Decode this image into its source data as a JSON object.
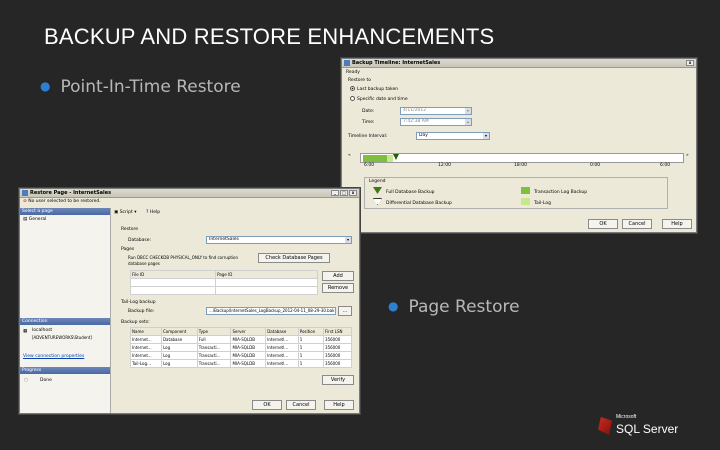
{
  "slide": {
    "title": "BACKUP AND RESTORE ENHANCEMENTS",
    "bullets": [
      "Point-In-Time Restore",
      "Page Restore"
    ]
  },
  "timeline_window": {
    "title": "Backup Timeline: InternetSales",
    "status": "Ready",
    "restore_to_label": "Restore to",
    "option_last": "Last backup taken",
    "option_specific": "Specific date and time",
    "date_label": "Date:",
    "date_value": "4/11/2012",
    "time_label": "Time:",
    "time_value": "7:42:38 AM",
    "interval_label": "Timeline Interval:",
    "interval_value": "Day",
    "ticks": [
      "6:00",
      "12:00",
      "18:00",
      "0:00",
      "6:00"
    ],
    "legend_label": "Legend",
    "legend": [
      {
        "label": "Full Database Backup",
        "color": "#3f7a1a"
      },
      {
        "label": "Transaction Log Backup",
        "color": "#7fbf3f"
      },
      {
        "label": "Differential Database Backup",
        "color": "#ffffff"
      },
      {
        "label": "Tail-Log",
        "color": "#c6e88a"
      }
    ],
    "ok": "OK",
    "cancel": "Cancel",
    "help": "Help"
  },
  "restore_window": {
    "title": "Restore Page - InternetSales",
    "warning": "No user selected to be restored.",
    "select_page": "Select a page",
    "page_general": "General",
    "toolbar_script": "Script",
    "toolbar_help": "Help",
    "restore_label": "Restore",
    "database_label": "Database:",
    "database_value": "InternetSales",
    "pages_label": "Pages",
    "pages_hint": "Run DBCC CHECKDB PHYSICAL_ONLY to find corruption",
    "pages_hint2": "database pages",
    "check_pages_btn": "Check Database Pages",
    "file_id_col": "File ID",
    "page_id_col": "Page ID",
    "add_btn": "Add",
    "remove_btn": "Remove",
    "tail_log_label": "Tail-Log backup",
    "backup_file_label": "Backup file:",
    "backup_file_value": "...\\Backup\\InternetSales_LogBackup_2012-04-11_08-29-30.bak",
    "backup_sets_label": "Backup sets:",
    "columns": [
      "Name",
      "Component",
      "Type",
      "Server",
      "Database",
      "Position",
      "First LSN"
    ],
    "rows": [
      [
        "Internet...",
        "Database",
        "Full",
        "MIA-SQLDB",
        "Internetl...",
        "1",
        "356000"
      ],
      [
        "Internet...",
        "Log",
        "Transacti...",
        "MIA-SQLDB",
        "Internetl...",
        "1",
        "356000"
      ],
      [
        "Internet...",
        "Log",
        "Transacti...",
        "MIA-SQLDB",
        "Internetl...",
        "1",
        "356000"
      ],
      [
        "Tail-Log...",
        "Log",
        "Transacti...",
        "MIA-SQLDB",
        "Internetl...",
        "1",
        "356000"
      ]
    ],
    "verify_btn": "Verify",
    "connection_label": "Connection",
    "server_name": "localhost",
    "user_name": "[ADVENTUREWORKS\\Student]",
    "view_conn": "View connection properties",
    "progress_label": "Progress",
    "progress_status": "Done",
    "ok": "OK",
    "cancel": "Cancel",
    "help": "Help"
  },
  "logo": {
    "company": "Microsoft",
    "product": "SQL Server"
  }
}
